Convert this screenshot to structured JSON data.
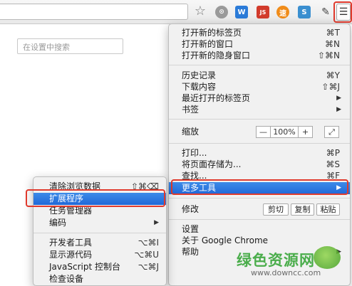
{
  "toolbar": {
    "star_glyph": "☆",
    "ext_icons": [
      "ext-grey-icon",
      "ext-w-icon",
      "ext-js-icon",
      "ext-orange-icon",
      "ext-s-icon",
      "ext-puzzle-icon"
    ],
    "ext_labels": [
      "⊙",
      "W",
      "JS",
      "速",
      "S",
      "✎"
    ],
    "menu_glyph": "☰"
  },
  "settings": {
    "search_placeholder": "在设置中搜索"
  },
  "main_menu": {
    "new_tab": {
      "label": "打开新的标签页",
      "shortcut": "⌘T"
    },
    "new_window": {
      "label": "打开新的窗口",
      "shortcut": "⌘N"
    },
    "new_incognito": {
      "label": "打开新的隐身窗口",
      "shortcut": "⇧⌘N"
    },
    "history": {
      "label": "历史记录",
      "shortcut": "⌘Y"
    },
    "downloads": {
      "label": "下载内容",
      "shortcut": "⇧⌘J"
    },
    "recent_tabs": {
      "label": "最近打开的标签页",
      "arrow": "▶"
    },
    "bookmarks": {
      "label": "书签",
      "arrow": "▶"
    },
    "zoom": {
      "label": "缩放",
      "minus": "—",
      "value": "100%",
      "plus": "+",
      "fullscreen": "⤢"
    },
    "print": {
      "label": "打印...",
      "shortcut": "⌘P"
    },
    "save_as": {
      "label": "将页面存储为...",
      "shortcut": "⌘S"
    },
    "find": {
      "label": "查找...",
      "shortcut": "⌘F"
    },
    "more_tools": {
      "label": "更多工具",
      "arrow": "▶"
    },
    "edit": {
      "label": "修改",
      "cut": "剪切",
      "copy": "复制",
      "paste": "粘贴"
    },
    "settings": {
      "label": "设置"
    },
    "about": {
      "label": "关于 Google Chrome"
    },
    "help": {
      "label": "帮助",
      "arrow": "▶"
    }
  },
  "sub_menu": {
    "clear_data": {
      "label": "清除浏览数据",
      "shortcut": "⇧⌘⌫"
    },
    "extensions": {
      "label": "扩展程序"
    },
    "task_manager": {
      "label": "任务管理器"
    },
    "encoding": {
      "label": "编码",
      "arrow": "▶"
    },
    "dev_tools": {
      "label": "开发者工具",
      "shortcut": "⌥⌘I"
    },
    "view_source": {
      "label": "显示源代码",
      "shortcut": "⌥⌘U"
    },
    "js_console": {
      "label": "JavaScript 控制台",
      "shortcut": "⌥⌘J"
    },
    "inspect_devices": {
      "label": "检查设备"
    }
  },
  "watermark": {
    "text": "绿色资源网",
    "url": "www.downcc.com"
  },
  "colors": {
    "highlight_blue": "#2a76e0",
    "annotation_red": "#e03a2d",
    "watermark_green": "#39a63a"
  }
}
